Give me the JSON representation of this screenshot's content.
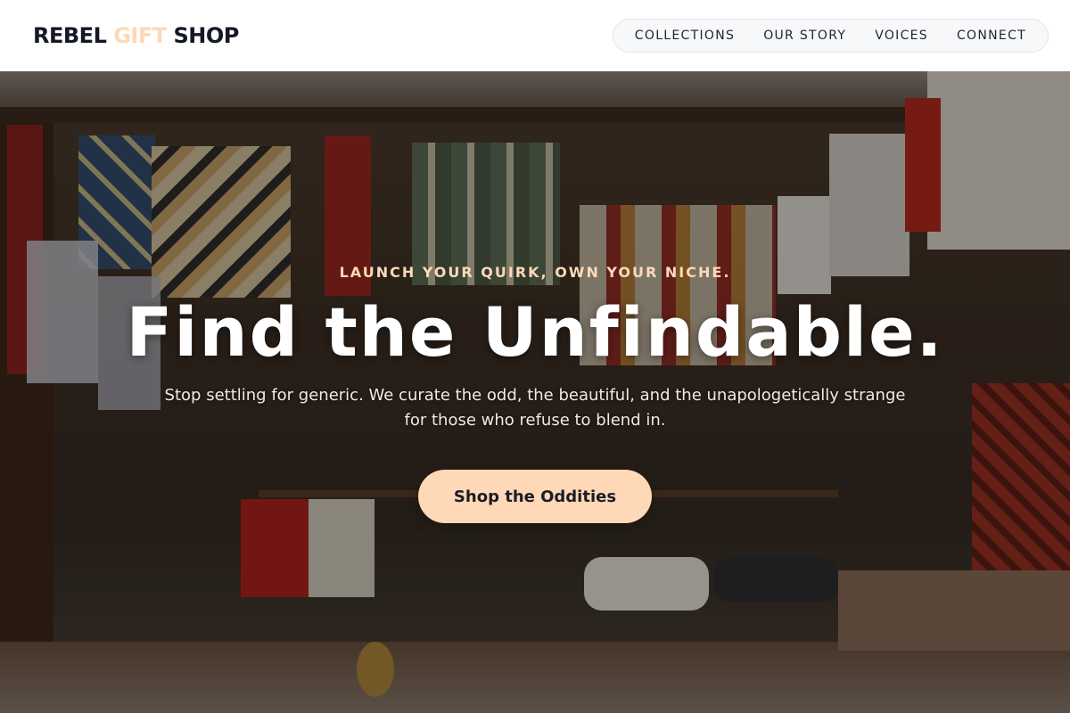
{
  "header": {
    "logo": {
      "part1": "REBEL",
      "part2": "GIFT",
      "part3": "SHOP"
    },
    "nav": [
      {
        "label": "COLLECTIONS"
      },
      {
        "label": "OUR STORY"
      },
      {
        "label": "VOICES"
      },
      {
        "label": "CONNECT"
      }
    ]
  },
  "hero": {
    "eyebrow": "LAUNCH YOUR QUIRK, OWN YOUR NICHE.",
    "title": "Find the Unfindable.",
    "subtitle_line1": "Stop settling for generic. We curate the odd, the beautiful, and the unapologetically strange",
    "subtitle_line2": "for those who refuse to blend in.",
    "cta_label": "Shop the Oddities"
  },
  "colors": {
    "accent": "#fcd9b8",
    "button_bg": "#fed8b7",
    "logo_text": "#141826"
  }
}
